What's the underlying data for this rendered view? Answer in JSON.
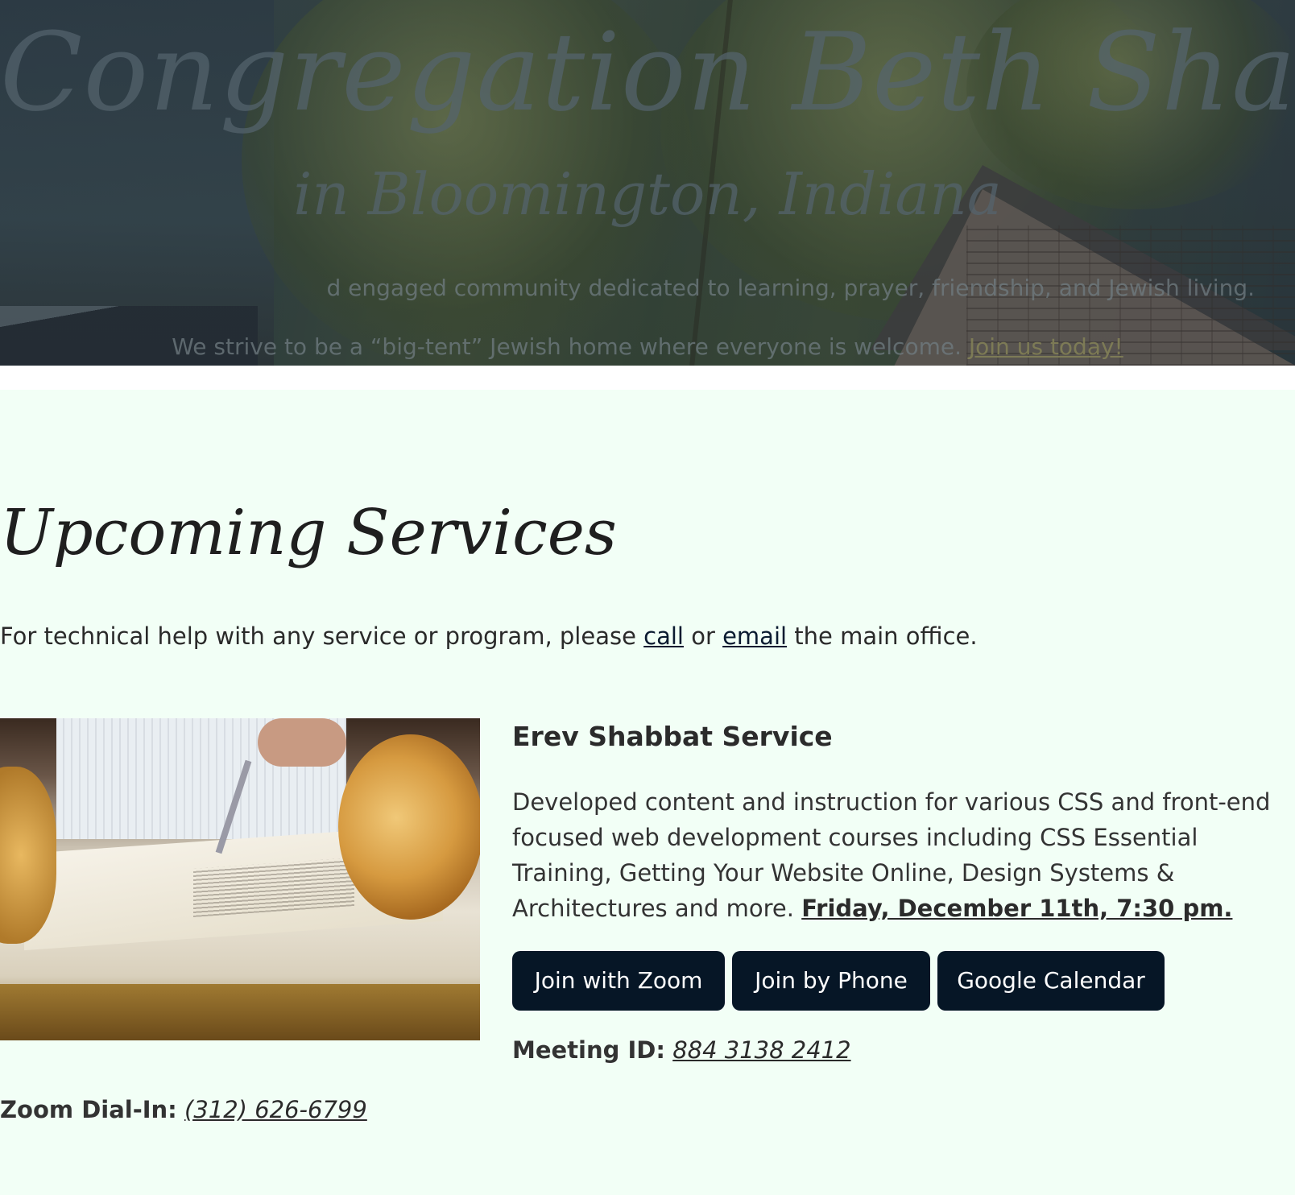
{
  "hero": {
    "title": "Congregation Beth Shalom",
    "subtitle": "in Bloomington, Indiana",
    "line1": "d engaged community dedicated to learning, prayer, friendship, and Jewish living.",
    "line2": "We strive to be a “big-tent” Jewish home where everyone is welcome.",
    "cta_link": "Join us today!"
  },
  "services": {
    "heading": "Upcoming Services",
    "help": {
      "prefix": "For technical help with any service or program, please ",
      "call_link": "call",
      "middle": " or ",
      "email_link": "email",
      "suffix": " the main office."
    },
    "items": [
      {
        "title": "Erev Shabbat Service",
        "description": "Developed content and instruction for various CSS and front-end focused web development courses including CSS Essential Training, Getting Your Website Online, Design Systems & Architectures and more.",
        "date_time": "Friday, December 11th, 7:30 pm.",
        "buttons": {
          "zoom": "Join with Zoom",
          "phone": "Join by Phone",
          "calendar": "Google Calendar"
        },
        "meeting_id_label": "Meeting ID:",
        "meeting_id": "884 3138 2412",
        "dial_in_label": "Zoom Dial-In:",
        "dial_in_number": "(312) 626-6799"
      }
    ]
  },
  "colors": {
    "main_background": "#f2fff6",
    "button_background": "#061626",
    "button_text": "#ffffff"
  }
}
